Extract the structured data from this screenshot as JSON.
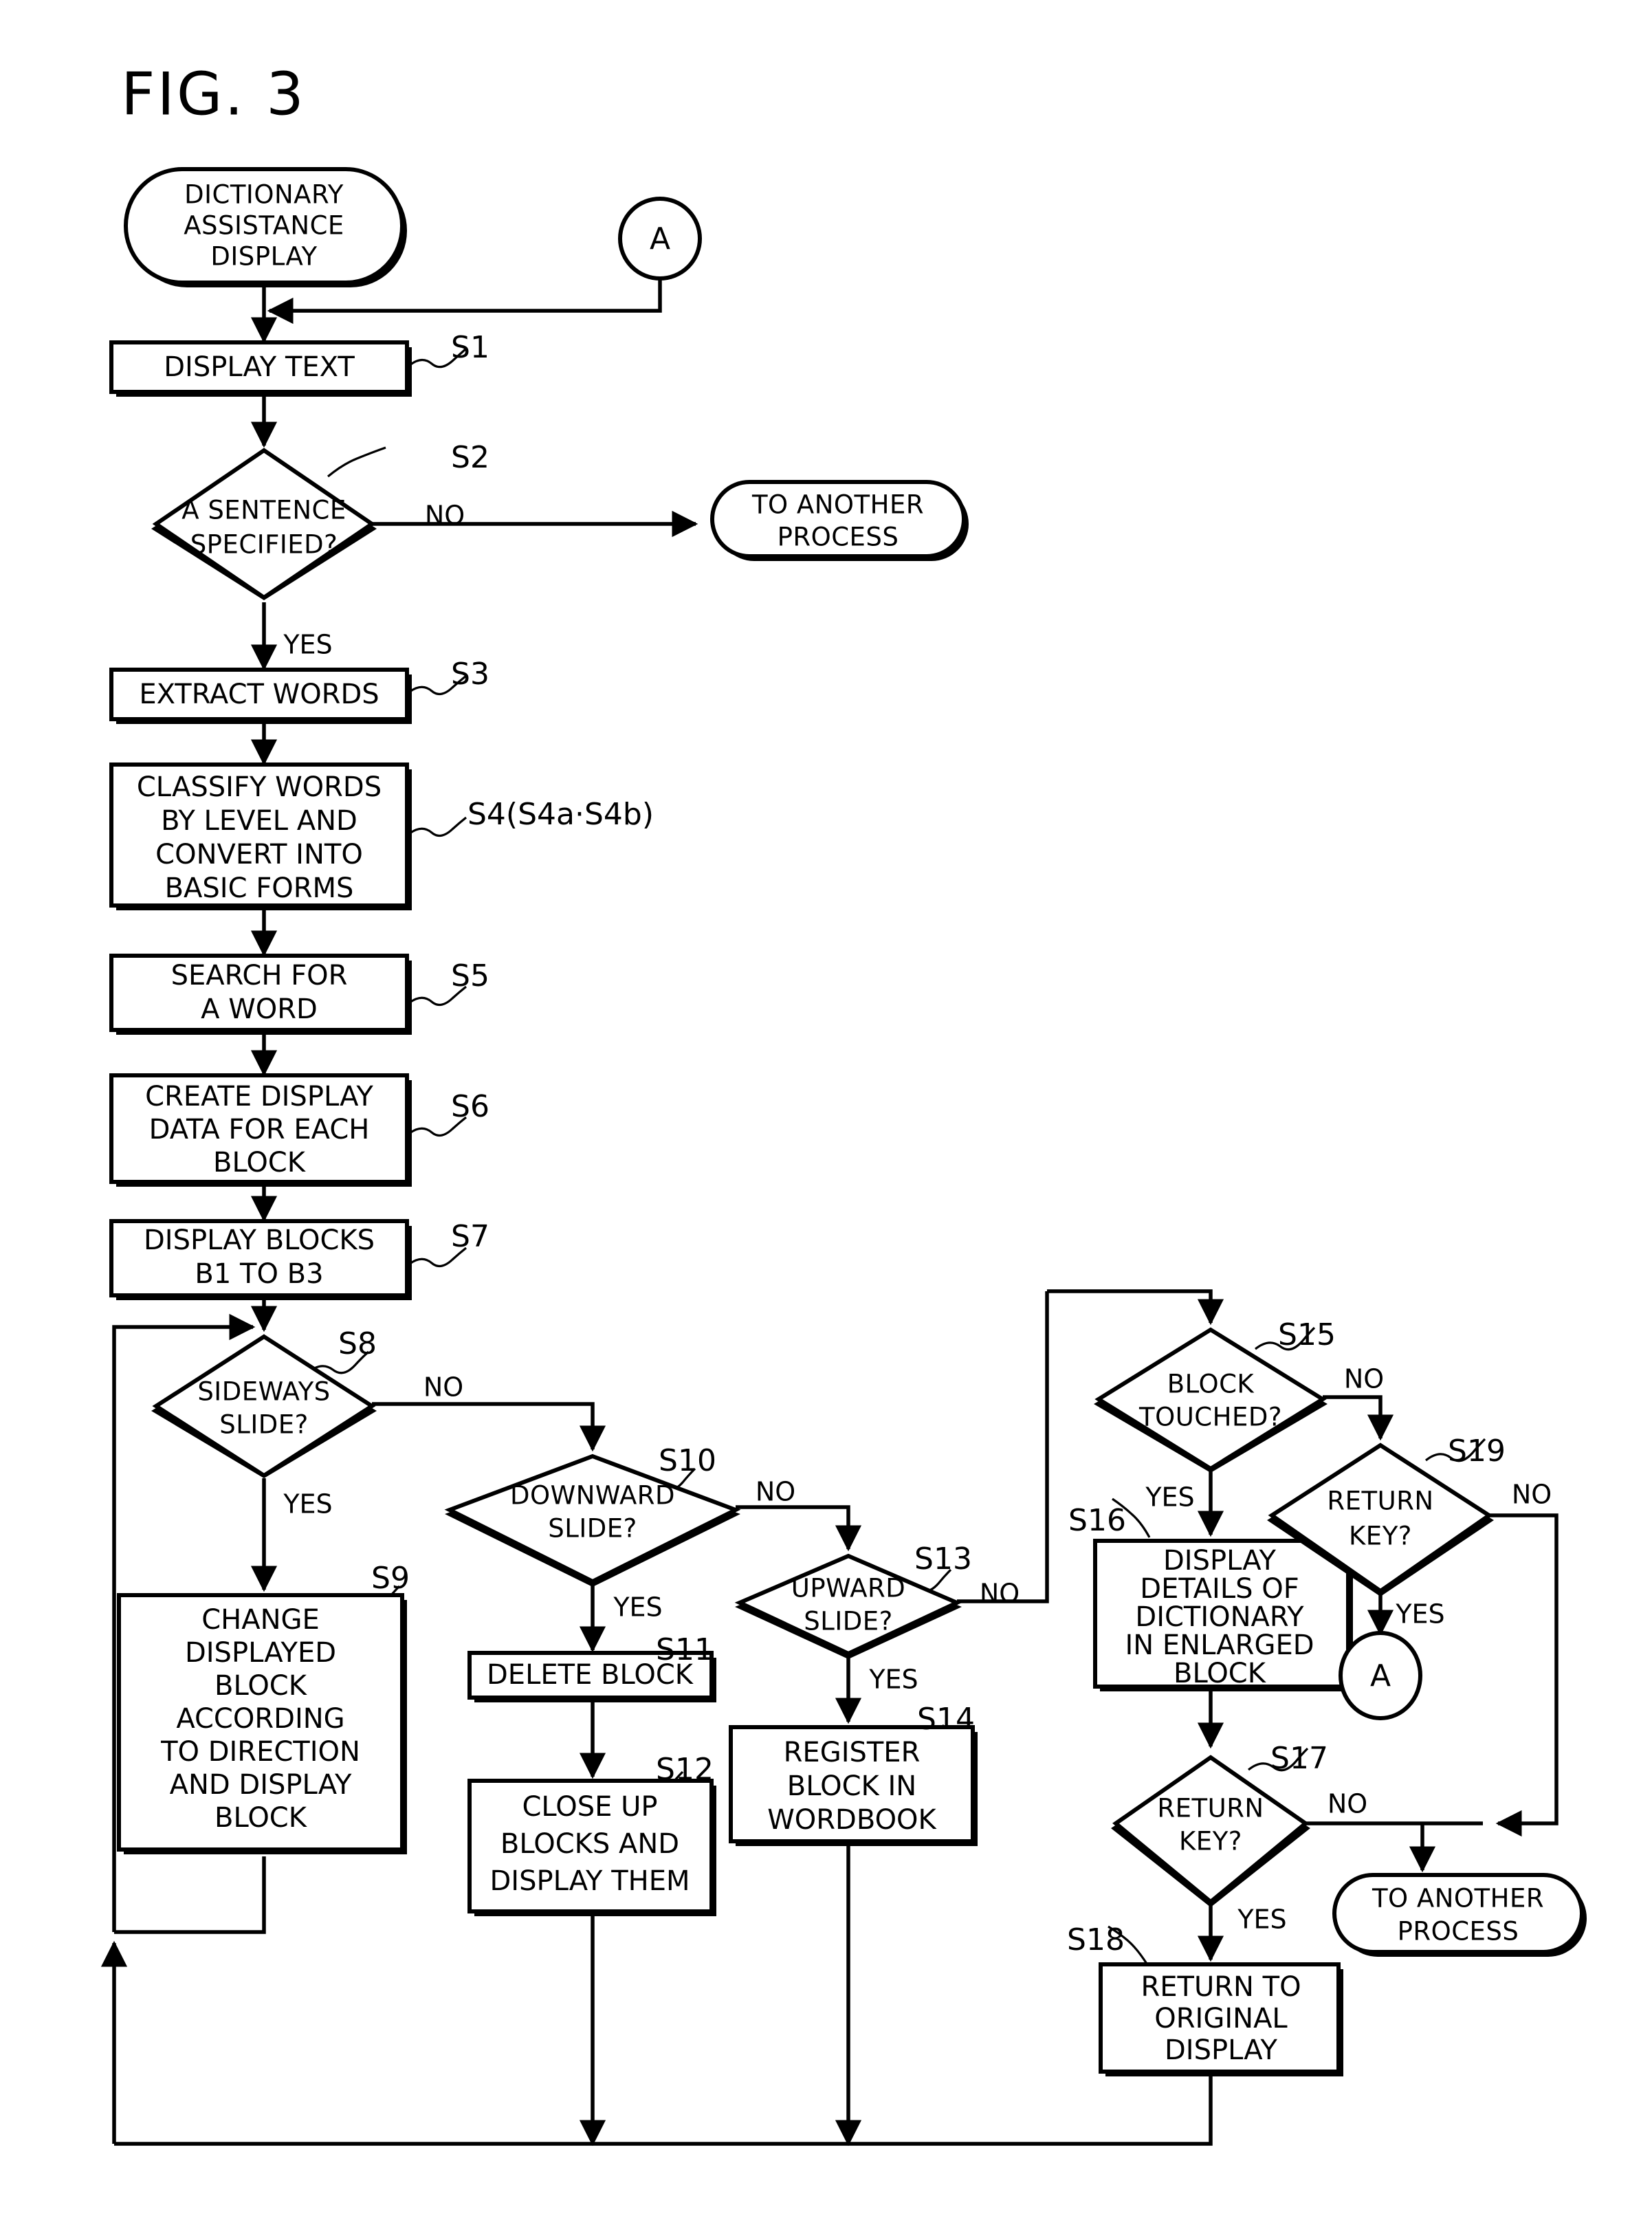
{
  "figure": {
    "title": "FIG. 3",
    "type": "flowchart"
  },
  "chart_data": {
    "type": "diagram",
    "title": "FIG. 3",
    "nodes": [
      {
        "id": "start",
        "shape": "terminator",
        "label": "DICTIONARY ASSISTANCE DISPLAY"
      },
      {
        "id": "connA_top",
        "shape": "connector",
        "label": "A"
      },
      {
        "id": "s1",
        "shape": "process",
        "step": "S1",
        "label": "DISPLAY TEXT"
      },
      {
        "id": "s2",
        "shape": "decision",
        "step": "S2",
        "label": "A SENTENCE SPECIFIED?"
      },
      {
        "id": "other1",
        "shape": "terminator",
        "label": "TO ANOTHER PROCESS"
      },
      {
        "id": "s3",
        "shape": "process",
        "step": "S3",
        "label": "EXTRACT WORDS"
      },
      {
        "id": "s4",
        "shape": "process",
        "step": "S4(S4a·S4b)",
        "label": "CLASSIFY WORDS BY LEVEL AND CONVERT INTO BASIC FORMS"
      },
      {
        "id": "s5",
        "shape": "process",
        "step": "S5",
        "label": "SEARCH FOR A WORD"
      },
      {
        "id": "s6",
        "shape": "process",
        "step": "S6",
        "label": "CREATE DISPLAY DATA FOR EACH BLOCK"
      },
      {
        "id": "s7",
        "shape": "process",
        "step": "S7",
        "label": "DISPLAY BLOCKS B1 TO B3"
      },
      {
        "id": "s8",
        "shape": "decision",
        "step": "S8",
        "label": "SIDEWAYS SLIDE?"
      },
      {
        "id": "s9",
        "shape": "process",
        "step": "S9",
        "label": "CHANGE DISPLAYED BLOCK ACCORDING TO DIRECTION AND DISPLAY BLOCK"
      },
      {
        "id": "s10",
        "shape": "decision",
        "step": "S10",
        "label": "DOWNWARD SLIDE?"
      },
      {
        "id": "s11",
        "shape": "process",
        "step": "S11",
        "label": "DELETE BLOCK"
      },
      {
        "id": "s12",
        "shape": "process",
        "step": "S12",
        "label": "CLOSE UP BLOCKS AND DISPLAY THEM"
      },
      {
        "id": "s13",
        "shape": "decision",
        "step": "S13",
        "label": "UPWARD SLIDE?"
      },
      {
        "id": "s14",
        "shape": "process",
        "step": "S14",
        "label": "REGISTER BLOCK IN WORDBOOK"
      },
      {
        "id": "s15",
        "shape": "decision",
        "step": "S15",
        "label": "BLOCK TOUCHED?"
      },
      {
        "id": "s16",
        "shape": "process",
        "step": "S16",
        "label": "DISPLAY DETAILS OF DICTIONARY IN ENLARGED BLOCK"
      },
      {
        "id": "s17",
        "shape": "decision",
        "step": "S17",
        "label": "RETURN KEY?"
      },
      {
        "id": "s18",
        "shape": "process",
        "step": "S18",
        "label": "RETURN TO ORIGINAL DISPLAY"
      },
      {
        "id": "s19",
        "shape": "decision",
        "step": "S19",
        "label": "RETURN KEY?"
      },
      {
        "id": "connA_bot",
        "shape": "connector",
        "label": "A"
      },
      {
        "id": "other2",
        "shape": "terminator",
        "label": "TO ANOTHER PROCESS"
      }
    ],
    "edges": [
      {
        "from": "start",
        "to": "s1"
      },
      {
        "from": "connA_top",
        "to": "s1"
      },
      {
        "from": "s1",
        "to": "s2"
      },
      {
        "from": "s2",
        "to": "other1",
        "label": "NO"
      },
      {
        "from": "s2",
        "to": "s3",
        "label": "YES"
      },
      {
        "from": "s3",
        "to": "s4"
      },
      {
        "from": "s4",
        "to": "s5"
      },
      {
        "from": "s5",
        "to": "s6"
      },
      {
        "from": "s6",
        "to": "s7"
      },
      {
        "from": "s7",
        "to": "s8"
      },
      {
        "from": "s8",
        "to": "s9",
        "label": "YES"
      },
      {
        "from": "s8",
        "to": "s10",
        "label": "NO"
      },
      {
        "from": "s9",
        "to": "s8"
      },
      {
        "from": "s10",
        "to": "s11",
        "label": "YES"
      },
      {
        "from": "s10",
        "to": "s13",
        "label": "NO"
      },
      {
        "from": "s11",
        "to": "s12"
      },
      {
        "from": "s12",
        "to": "s8"
      },
      {
        "from": "s13",
        "to": "s14",
        "label": "YES"
      },
      {
        "from": "s13",
        "to": "s15",
        "label": "NO"
      },
      {
        "from": "s14",
        "to": "s8"
      },
      {
        "from": "s15",
        "to": "s16",
        "label": "YES"
      },
      {
        "from": "s15",
        "to": "s19",
        "label": "NO"
      },
      {
        "from": "s16",
        "to": "s17"
      },
      {
        "from": "s17",
        "to": "s18",
        "label": "YES"
      },
      {
        "from": "s17",
        "to": "other2",
        "label": "NO"
      },
      {
        "from": "s18",
        "to": "s8"
      },
      {
        "from": "s19",
        "to": "connA_bot",
        "label": "YES"
      },
      {
        "from": "s19",
        "to": "other2",
        "label": "NO"
      }
    ],
    "edge_labels": [
      "YES",
      "NO"
    ]
  },
  "labels": {
    "yes": "YES",
    "no": "NO",
    "connector_a": "A",
    "start": "DICTIONARY\nASSISTANCE\nDISPLAY",
    "start_l1": "DICTIONARY",
    "start_l2": "ASSISTANCE",
    "start_l3": "DISPLAY",
    "other_l1": "TO ANOTHER",
    "other_l2": "PROCESS",
    "s1": "DISPLAY TEXT",
    "s2_l1": "A SENTENCE",
    "s2_l2": "SPECIFIED?",
    "s3": "EXTRACT WORDS",
    "s4_l1": "CLASSIFY WORDS",
    "s4_l2": "BY LEVEL AND",
    "s4_l3": "CONVERT INTO",
    "s4_l4": "BASIC FORMS",
    "s5_l1": "SEARCH FOR",
    "s5_l2": "A WORD",
    "s6_l1": "CREATE DISPLAY",
    "s6_l2": "DATA FOR EACH",
    "s6_l3": "BLOCK",
    "s7_l1": "DISPLAY BLOCKS",
    "s7_l2": "B1 TO B3",
    "s8_l1": "SIDEWAYS",
    "s8_l2": "SLIDE?",
    "s9_l1": "CHANGE",
    "s9_l2": "DISPLAYED",
    "s9_l3": "BLOCK",
    "s9_l4": "ACCORDING",
    "s9_l5": "TO DIRECTION",
    "s9_l6": "AND DISPLAY",
    "s9_l7": "BLOCK",
    "s10_l1": "DOWNWARD",
    "s10_l2": "SLIDE?",
    "s11": "DELETE BLOCK",
    "s12_l1": "CLOSE UP",
    "s12_l2": "BLOCKS AND",
    "s12_l3": "DISPLAY THEM",
    "s13_l1": "UPWARD",
    "s13_l2": "SLIDE?",
    "s14_l1": "REGISTER",
    "s14_l2": "BLOCK IN",
    "s14_l3": "WORDBOOK",
    "s15_l1": "BLOCK",
    "s15_l2": "TOUCHED?",
    "s16_l1": "DISPLAY",
    "s16_l2": "DETAILS OF",
    "s16_l3": "DICTIONARY",
    "s16_l4": "IN ENLARGED",
    "s16_l5": "BLOCK",
    "s17_l1": "RETURN",
    "s17_l2": "KEY?",
    "s18_l1": "RETURN TO",
    "s18_l2": "ORIGINAL",
    "s18_l3": "DISPLAY",
    "s19_l1": "RETURN",
    "s19_l2": "KEY?"
  },
  "steps": {
    "s1": "S1",
    "s2": "S2",
    "s3": "S3",
    "s4": "S4(S4a·S4b)",
    "s5": "S5",
    "s6": "S6",
    "s7": "S7",
    "s8": "S8",
    "s9": "S9",
    "s10": "S10",
    "s11": "S11",
    "s12": "S12",
    "s13": "S13",
    "s14": "S14",
    "s15": "S15",
    "s16": "S16",
    "s17": "S17",
    "s18": "S18",
    "s19": "S19"
  },
  "colors": {
    "stroke": "#000000",
    "fill": "#ffffff"
  }
}
